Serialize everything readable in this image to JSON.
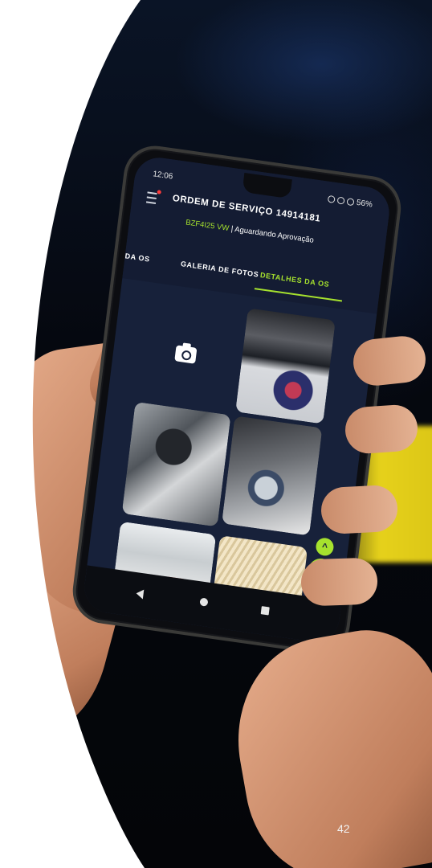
{
  "page": {
    "number": "42"
  },
  "phone": {
    "status_bar": {
      "time": "12:06",
      "battery": "56%"
    },
    "app": {
      "title": "ORDEM DE SERVIÇO 14914181",
      "plate": "BZF4I25 VW",
      "status": "| Aguardando Aprovação",
      "tabs": [
        {
          "label": "DA OS",
          "active": false
        },
        {
          "label": "GALERIA DE FOTOS",
          "active": false
        },
        {
          "label": "DETALHES DA OS",
          "active": true
        }
      ]
    },
    "icons": {
      "menu": "menu-icon",
      "camera": "camera-icon",
      "scroll_up": "chevron-up-icon",
      "chat": "chat-icon",
      "nav_back": "back-triangle-icon",
      "nav_home": "home-circle-icon",
      "nav_recent": "recent-square-icon"
    },
    "accent_color": "#a6e22e"
  }
}
